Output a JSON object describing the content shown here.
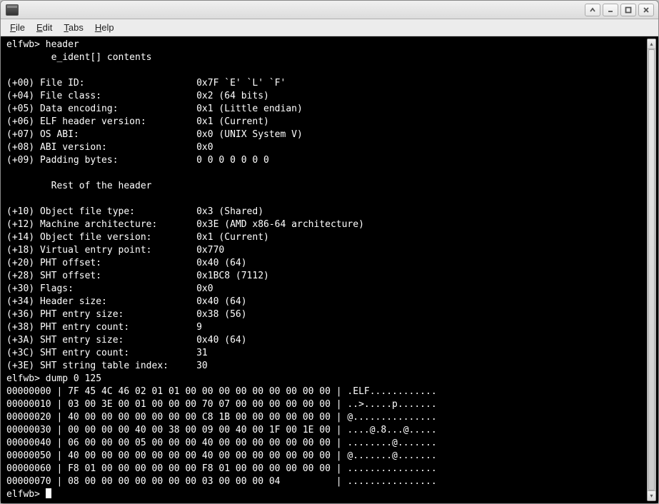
{
  "titlebar": {
    "title": ""
  },
  "menubar": {
    "items": [
      {
        "u": "F",
        "rest": "ile"
      },
      {
        "u": "E",
        "rest": "dit"
      },
      {
        "u": "T",
        "rest": "abs"
      },
      {
        "u": "H",
        "rest": "elp"
      }
    ]
  },
  "terminal": {
    "prompt": "elfwb>",
    "commands": {
      "header": "header",
      "dump": "dump 0 125"
    },
    "ident_heading": "e_ident[] contents",
    "rest_heading": "Rest of the header",
    "ident_rows": [
      {
        "off": "(+00)",
        "label": "File ID:",
        "val": "0x7F `E' `L' `F'"
      },
      {
        "off": "(+04)",
        "label": "File class:",
        "val": "0x2 (64 bits)"
      },
      {
        "off": "(+05)",
        "label": "Data encoding:",
        "val": "0x1 (Little endian)"
      },
      {
        "off": "(+06)",
        "label": "ELF header version:",
        "val": "0x1 (Current)"
      },
      {
        "off": "(+07)",
        "label": "OS ABI:",
        "val": "0x0 (UNIX System V)"
      },
      {
        "off": "(+08)",
        "label": "ABI version:",
        "val": "0x0"
      },
      {
        "off": "(+09)",
        "label": "Padding bytes:",
        "val": "0 0 0 0 0 0 0"
      }
    ],
    "rest_rows": [
      {
        "off": "(+10)",
        "label": "Object file type:",
        "val": "0x3 (Shared)"
      },
      {
        "off": "(+12)",
        "label": "Machine architecture:",
        "val": "0x3E (AMD x86-64 architecture)"
      },
      {
        "off": "(+14)",
        "label": "Object file version:",
        "val": "0x1 (Current)"
      },
      {
        "off": "(+18)",
        "label": "Virtual entry point:",
        "val": "0x770"
      },
      {
        "off": "(+20)",
        "label": "PHT offset:",
        "val": "0x40 (64)"
      },
      {
        "off": "(+28)",
        "label": "SHT offset:",
        "val": "0x1BC8 (7112)"
      },
      {
        "off": "(+30)",
        "label": "Flags:",
        "val": "0x0"
      },
      {
        "off": "(+34)",
        "label": "Header size:",
        "val": "0x40 (64)"
      },
      {
        "off": "(+36)",
        "label": "PHT entry size:",
        "val": "0x38 (56)"
      },
      {
        "off": "(+38)",
        "label": "PHT entry count:",
        "val": "9"
      },
      {
        "off": "(+3A)",
        "label": "SHT entry size:",
        "val": "0x40 (64)"
      },
      {
        "off": "(+3C)",
        "label": "SHT entry count:",
        "val": "31"
      },
      {
        "off": "(+3E)",
        "label": "SHT string table index:",
        "val": "30"
      }
    ],
    "dump_rows": [
      {
        "addr": "00000000",
        "hex": "7F 45 4C 46 02 01 01 00 00 00 00 00 00 00 00 00",
        "ascii": ".ELF............"
      },
      {
        "addr": "00000010",
        "hex": "03 00 3E 00 01 00 00 00 70 07 00 00 00 00 00 00",
        "ascii": "..>.....p......."
      },
      {
        "addr": "00000020",
        "hex": "40 00 00 00 00 00 00 00 C8 1B 00 00 00 00 00 00",
        "ascii": "@..............."
      },
      {
        "addr": "00000030",
        "hex": "00 00 00 00 40 00 38 00 09 00 40 00 1F 00 1E 00",
        "ascii": "....@.8...@....."
      },
      {
        "addr": "00000040",
        "hex": "06 00 00 00 05 00 00 00 40 00 00 00 00 00 00 00",
        "ascii": "........@......."
      },
      {
        "addr": "00000050",
        "hex": "40 00 00 00 00 00 00 00 40 00 00 00 00 00 00 00",
        "ascii": "@.......@......."
      },
      {
        "addr": "00000060",
        "hex": "F8 01 00 00 00 00 00 00 F8 01 00 00 00 00 00 00",
        "ascii": "................"
      },
      {
        "addr": "00000070",
        "hex": "08 00 00 00 00 00 00 00 03 00 00 00 04         ",
        "ascii": "................"
      }
    ]
  }
}
